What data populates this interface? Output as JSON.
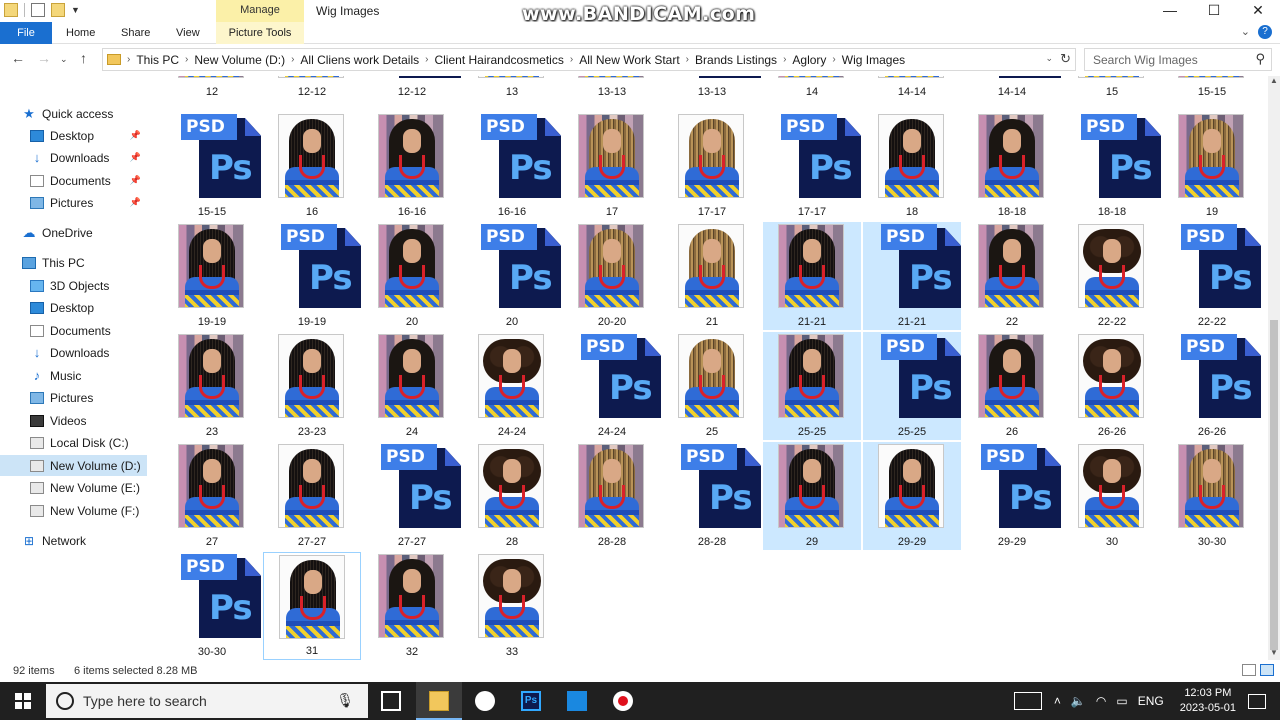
{
  "titlebar": {
    "manage_tab": "Manage",
    "title": "Wig Images",
    "watermark": "www.BANDICAM.com",
    "controls": [
      "—",
      "☐",
      "✕"
    ]
  },
  "ribbon": {
    "file": "File",
    "tabs": [
      "Home",
      "Share",
      "View"
    ],
    "context_tab": "Picture Tools"
  },
  "address": {
    "crumbs": [
      "This PC",
      "New Volume (D:)",
      "All Cliens work Details",
      "Client Hairandcosmetics",
      "All New Work Start",
      "Brands Listings",
      "Aglory",
      "Wig Images"
    ],
    "search_placeholder": "Search Wig Images"
  },
  "sidebar": {
    "items": [
      {
        "label": "Quick access",
        "icon": "star-icon",
        "pinned": false
      },
      {
        "label": "Desktop",
        "icon": "desktop-icon",
        "pinned": true
      },
      {
        "label": "Downloads",
        "icon": "download-icon",
        "pinned": true
      },
      {
        "label": "Documents",
        "icon": "documents-icon",
        "pinned": true
      },
      {
        "label": "Pictures",
        "icon": "pictures-icon",
        "pinned": true
      },
      {
        "label": "OneDrive",
        "icon": "cloud-icon",
        "pinned": false
      },
      {
        "label": "This PC",
        "icon": "computer-icon",
        "pinned": false
      },
      {
        "label": "3D Objects",
        "icon": "3d-objects-icon",
        "pinned": false
      },
      {
        "label": "Desktop",
        "icon": "desktop-icon",
        "pinned": false
      },
      {
        "label": "Documents",
        "icon": "documents-icon",
        "pinned": false
      },
      {
        "label": "Downloads",
        "icon": "download-icon",
        "pinned": false
      },
      {
        "label": "Music",
        "icon": "music-icon",
        "pinned": false
      },
      {
        "label": "Pictures",
        "icon": "pictures-icon",
        "pinned": false
      },
      {
        "label": "Videos",
        "icon": "videos-icon",
        "pinned": false
      },
      {
        "label": "Local Disk (C:)",
        "icon": "drive-icon",
        "pinned": false
      },
      {
        "label": "New Volume (D:)",
        "icon": "drive-icon",
        "pinned": false,
        "selected": true
      },
      {
        "label": "New Volume (E:)",
        "icon": "drive-icon",
        "pinned": false
      },
      {
        "label": "New Volume (F:)",
        "icon": "drive-icon",
        "pinned": false
      },
      {
        "label": "Network",
        "icon": "network-icon",
        "pinned": false
      }
    ]
  },
  "files": [
    {
      "name": "12",
      "type": "img"
    },
    {
      "name": "12-12",
      "type": "img"
    },
    {
      "name": "12-12",
      "type": "psd"
    },
    {
      "name": "13",
      "type": "img"
    },
    {
      "name": "13-13",
      "type": "img"
    },
    {
      "name": "13-13",
      "type": "psd"
    },
    {
      "name": "14",
      "type": "img"
    },
    {
      "name": "14-14",
      "type": "img"
    },
    {
      "name": "14-14",
      "type": "psd"
    },
    {
      "name": "15",
      "type": "img"
    },
    {
      "name": "15-15",
      "type": "img"
    },
    {
      "name": "15-15",
      "type": "psd"
    },
    {
      "name": "16",
      "type": "img"
    },
    {
      "name": "16-16",
      "type": "img"
    },
    {
      "name": "16-16",
      "type": "psd"
    },
    {
      "name": "17",
      "type": "img"
    },
    {
      "name": "17-17",
      "type": "img"
    },
    {
      "name": "17-17",
      "type": "psd"
    },
    {
      "name": "18",
      "type": "img"
    },
    {
      "name": "18-18",
      "type": "img"
    },
    {
      "name": "18-18",
      "type": "psd"
    },
    {
      "name": "19",
      "type": "img"
    },
    {
      "name": "19-19",
      "type": "img"
    },
    {
      "name": "19-19",
      "type": "psd"
    },
    {
      "name": "20",
      "type": "img"
    },
    {
      "name": "20",
      "type": "psd"
    },
    {
      "name": "20-20",
      "type": "img"
    },
    {
      "name": "21",
      "type": "img"
    },
    {
      "name": "21-21",
      "type": "img",
      "selected": true
    },
    {
      "name": "21-21",
      "type": "psd",
      "selected": true
    },
    {
      "name": "22",
      "type": "img"
    },
    {
      "name": "22-22",
      "type": "img"
    },
    {
      "name": "22-22",
      "type": "psd"
    },
    {
      "name": "23",
      "type": "img"
    },
    {
      "name": "23-23",
      "type": "img"
    },
    {
      "name": "24",
      "type": "img"
    },
    {
      "name": "24-24",
      "type": "img"
    },
    {
      "name": "24-24",
      "type": "psd"
    },
    {
      "name": "25",
      "type": "img"
    },
    {
      "name": "25-25",
      "type": "img",
      "selected": true
    },
    {
      "name": "25-25",
      "type": "psd",
      "selected": true
    },
    {
      "name": "26",
      "type": "img"
    },
    {
      "name": "26-26",
      "type": "img"
    },
    {
      "name": "26-26",
      "type": "psd"
    },
    {
      "name": "27",
      "type": "img"
    },
    {
      "name": "27-27",
      "type": "img"
    },
    {
      "name": "27-27",
      "type": "psd"
    },
    {
      "name": "28",
      "type": "img"
    },
    {
      "name": "28-28",
      "type": "img"
    },
    {
      "name": "28-28",
      "type": "psd"
    },
    {
      "name": "29",
      "type": "img",
      "selected": true
    },
    {
      "name": "29-29",
      "type": "img",
      "selected": true
    },
    {
      "name": "29-29",
      "type": "psd"
    },
    {
      "name": "30",
      "type": "img"
    },
    {
      "name": "30-30",
      "type": "img"
    },
    {
      "name": "30-30",
      "type": "psd"
    },
    {
      "name": "31",
      "type": "img",
      "focus": true
    },
    {
      "name": "32",
      "type": "img"
    },
    {
      "name": "33",
      "type": "img"
    }
  ],
  "psd_icon": {
    "tag": "PSD",
    "glyph": "Ps"
  },
  "status": {
    "count": "92 items",
    "selected": "6 items selected  8.28 MB"
  },
  "taskbar": {
    "search_placeholder": "Type here to search",
    "lang": "ENG",
    "time": "12:03 PM",
    "date": "2023-05-01"
  },
  "colors": {
    "accent": "#1a6fd0",
    "selection": "#cce8ff",
    "psd_dark": "#0d1a4f",
    "psd_light": "#3e7ee8"
  }
}
